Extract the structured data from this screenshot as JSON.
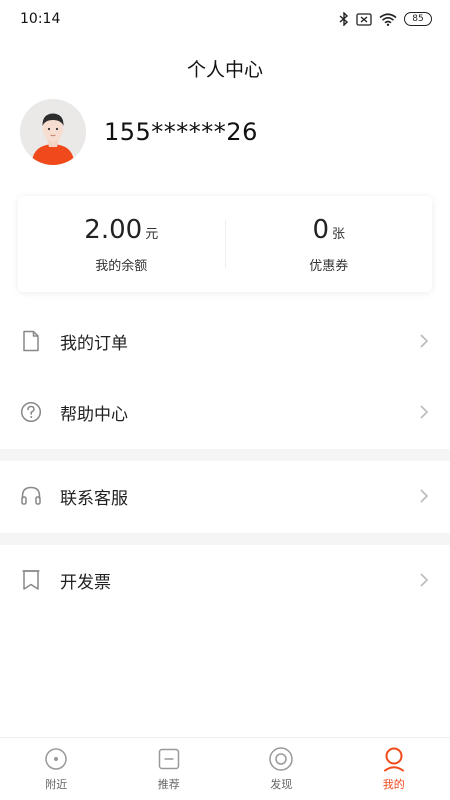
{
  "status_bar": {
    "time": "10:14",
    "battery": "85"
  },
  "header": {
    "title": "个人中心"
  },
  "profile": {
    "phone": "155******26"
  },
  "wallet": {
    "balance": {
      "value": "2.00",
      "unit": "元",
      "label": "我的余额"
    },
    "coupons": {
      "value": "0",
      "unit": "张",
      "label": "优惠券"
    }
  },
  "menu": [
    {
      "label": "我的订单",
      "icon": "document-icon"
    },
    {
      "label": "帮助中心",
      "icon": "question-icon"
    },
    {
      "label": "联系客服",
      "icon": "headset-icon"
    },
    {
      "label": "开发票",
      "icon": "receipt-icon"
    }
  ],
  "tabs": [
    {
      "label": "附近",
      "icon": "location-icon",
      "active": false
    },
    {
      "label": "推荐",
      "icon": "recommend-icon",
      "active": false
    },
    {
      "label": "发现",
      "icon": "discover-icon",
      "active": false
    },
    {
      "label": "我的",
      "icon": "user-icon",
      "active": true
    }
  ],
  "colors": {
    "accent": "#f04a1c",
    "icon_gray": "#999999"
  }
}
